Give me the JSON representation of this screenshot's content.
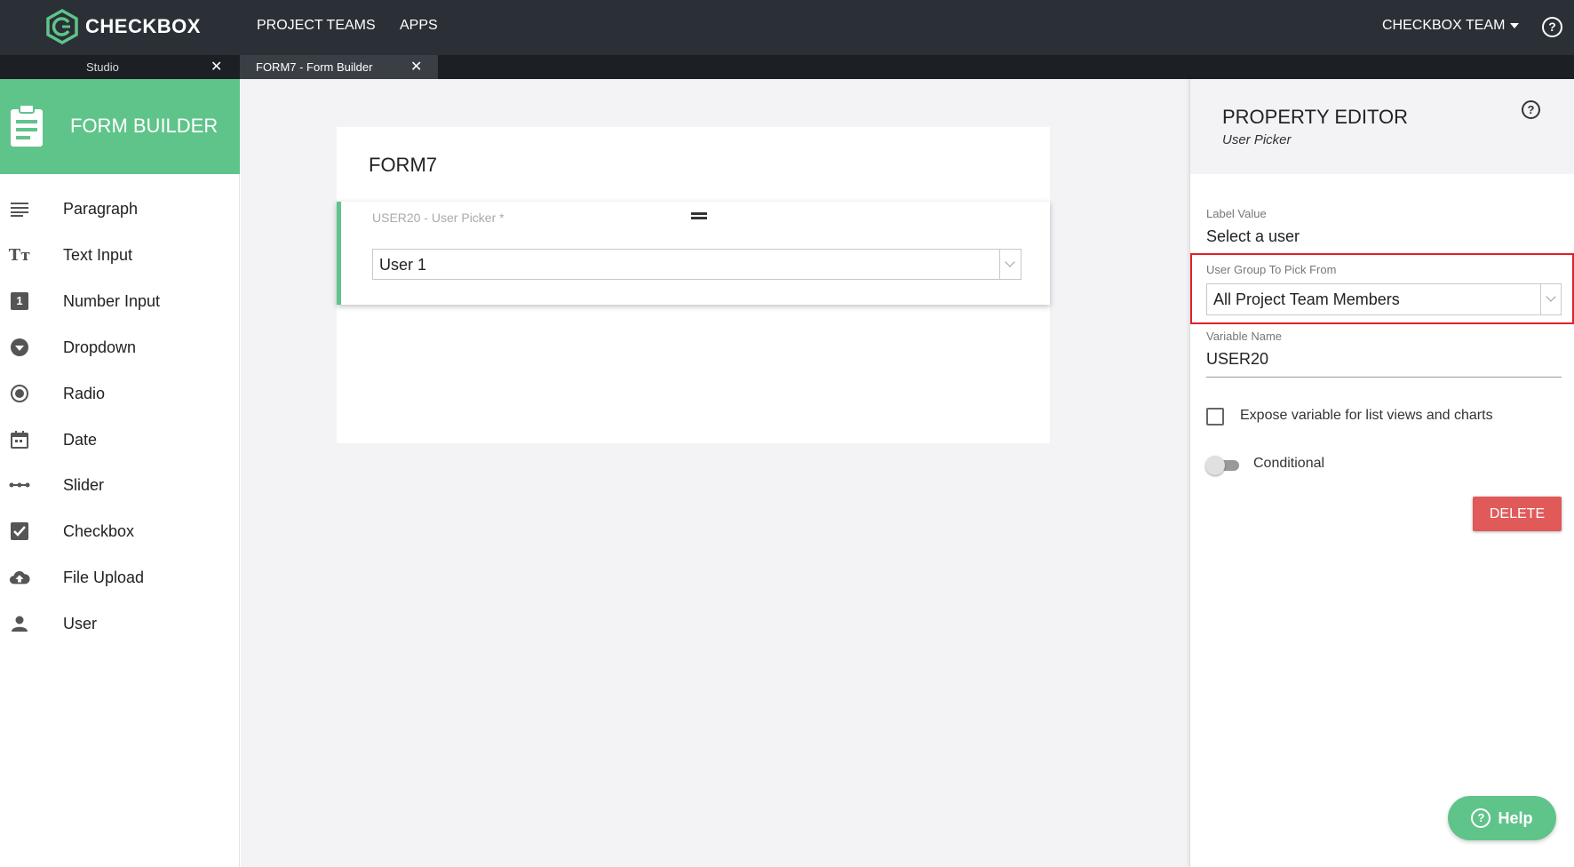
{
  "app": {
    "brand": "CHECKBOX",
    "nav": [
      "PROJECT TEAMS",
      "APPS"
    ],
    "team_menu": "CHECKBOX TEAM",
    "help_glyph": "?"
  },
  "tabs": [
    {
      "label": "Studio",
      "close": "✕",
      "active": false
    },
    {
      "label": "FORM7 - Form Builder",
      "close": "✕",
      "active": true
    }
  ],
  "sidebar": {
    "title": "FORM BUILDER",
    "items": [
      {
        "label": "Paragraph",
        "icon": "paragraph-icon"
      },
      {
        "label": "Text Input",
        "icon": "text-input-icon",
        "glyph": "Tт"
      },
      {
        "label": "Number Input",
        "icon": "number-input-icon",
        "glyph": "1"
      },
      {
        "label": "Dropdown",
        "icon": "dropdown-icon"
      },
      {
        "label": "Radio",
        "icon": "radio-icon"
      },
      {
        "label": "Date",
        "icon": "calendar-icon"
      },
      {
        "label": "Slider",
        "icon": "slider-icon"
      },
      {
        "label": "Checkbox",
        "icon": "checkbox-icon"
      },
      {
        "label": "File Upload",
        "icon": "cloud-upload-icon"
      },
      {
        "label": "User",
        "icon": "user-icon"
      }
    ]
  },
  "form": {
    "title": "FORM7",
    "field": {
      "label": "USER20 - User Picker *",
      "value": "User 1"
    }
  },
  "property_editor": {
    "title": "PROPERTY EDITOR",
    "subtitle": "User Picker",
    "help_glyph": "?",
    "label_value_label": "Label Value",
    "label_value": "Select a user",
    "user_group_label": "User Group To Pick From",
    "user_group_value": "All Project Team Members",
    "variable_name_label": "Variable Name",
    "variable_name_value": "USER20",
    "expose_label": "Expose variable for list views and charts",
    "conditional_label": "Conditional",
    "delete_label": "DELETE"
  },
  "help_button": {
    "label": "Help",
    "glyph": "?"
  },
  "colors": {
    "topbar": "#2b3037",
    "accent_green": "#5fc48a",
    "delete_red": "#e05a5a",
    "highlight_red": "#e0212a"
  }
}
